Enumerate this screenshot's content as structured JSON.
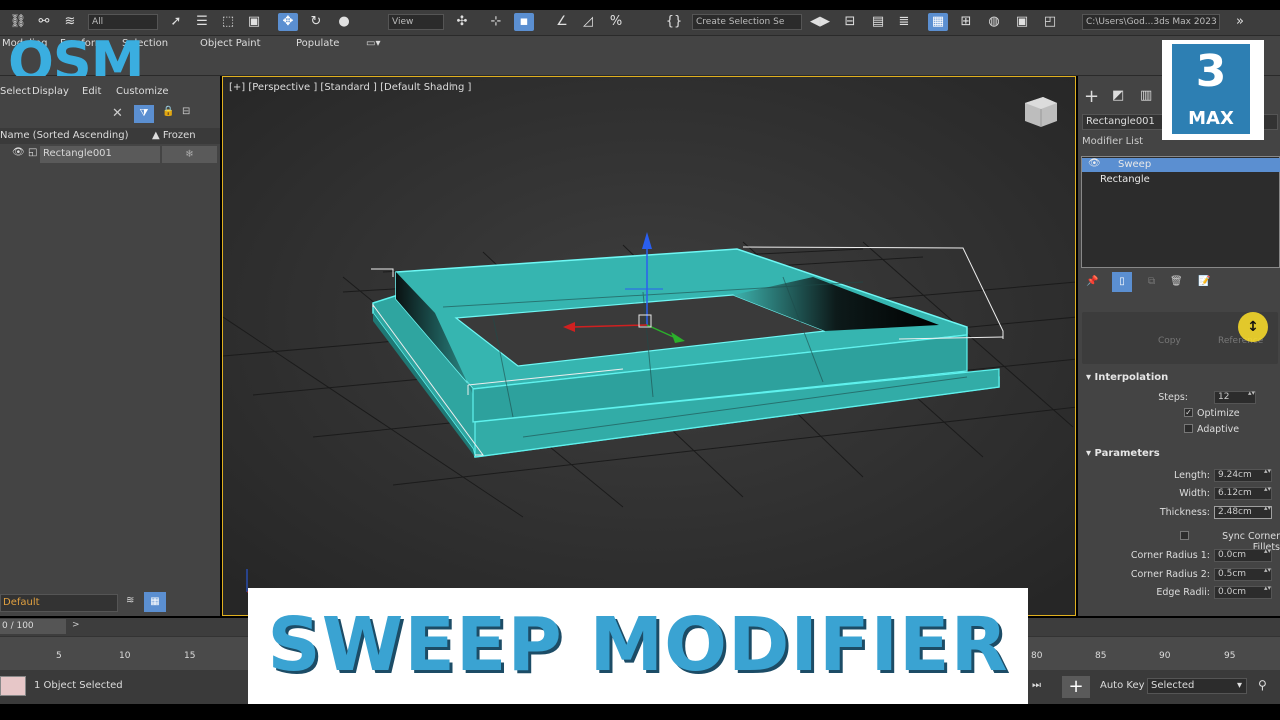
{
  "toolbar": {
    "project_path": "C:\\Users\\God...3ds Max 2023",
    "field_left": "All",
    "field_mid": "Create Selection Se"
  },
  "ribbon": {
    "tabs": [
      "Modeling",
      "Freeform",
      "Selection",
      "Object Paint",
      "Populate"
    ]
  },
  "watermark": {
    "osm": "OSM",
    "max_number": "3",
    "max_label": "MAX"
  },
  "scene_explorer": {
    "menu": [
      "Select",
      "Display",
      "Edit",
      "Customize"
    ],
    "column_name": "Name (Sorted Ascending)",
    "column_frozen": "▲ Frozen",
    "rows": [
      {
        "name": "Rectangle001",
        "frozen_icon": "❄"
      }
    ],
    "layer": "Default"
  },
  "viewport": {
    "label": "[+] [Perspective ] [Standard ] [Default Shading ]"
  },
  "command_panel": {
    "object_name": "Rectangle001",
    "modifier_list_label": "Modifier List",
    "stack": [
      "Sweep",
      "Rectangle"
    ],
    "copy_label": "Copy",
    "reference_label": "Reference",
    "interpolation": {
      "title": "Interpolation",
      "steps_label": "Steps:",
      "steps_value": "12",
      "optimize_label": "Optimize",
      "optimize_checked": true,
      "adaptive_label": "Adaptive",
      "adaptive_checked": false
    },
    "parameters": {
      "title": "Parameters",
      "length_label": "Length:",
      "length_value": "9.24cm",
      "width_label": "Width:",
      "width_value": "6.12cm",
      "thickness_label": "Thickness:",
      "thickness_value": "2.48cm",
      "sync_label": "Sync Corner Fillets",
      "corner1_label": "Corner Radius 1:",
      "corner1_value": "0.0cm",
      "corner2_label": "Corner Radius 2:",
      "corner2_value": "0.5cm",
      "edge_label": "Edge Radii:",
      "edge_value": "0.0cm"
    }
  },
  "timeline": {
    "slider": "0 / 100",
    "ticks": [
      "5",
      "10",
      "15",
      "80",
      "85",
      "90",
      "95"
    ]
  },
  "status": {
    "selection_text": "1 Object Selected",
    "autokey": "Auto Key",
    "selected": "Selected"
  },
  "banner": {
    "title": "SWEEP MODIFIER"
  },
  "colors": {
    "object": "#36b5b0",
    "accent": "#5b8fd1",
    "viewport_border": "#e0b020",
    "banner_text": "#3aa3d2"
  }
}
